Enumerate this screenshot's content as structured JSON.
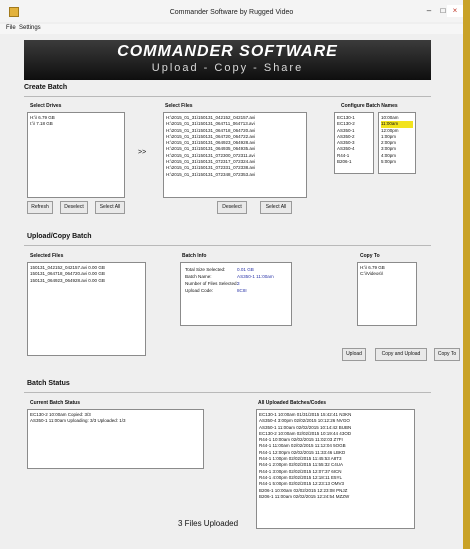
{
  "window": {
    "title": "Commander Software by Rugged Video",
    "minimize": "–",
    "maximize": "□",
    "close": "×"
  },
  "menu": {
    "file": "File",
    "settings": "Settings"
  },
  "banner": {
    "title": "COMMANDER SOFTWARE",
    "subtitle": "Upload - Copy - Share"
  },
  "create_batch": {
    "heading": "Create Batch",
    "select_drives_label": "Select Drives",
    "drives": [
      "H:\\\\ 6.79 GB",
      "I:\\\\ 7.18 GB"
    ],
    "select_files_label": "Select Files",
    "arrow": ">>",
    "files": [
      "H:\\2015_01_31\\150131_042152_042157.avi",
      "H:\\2015_01_31\\150131_064711_064713.avi",
      "H:\\2015_01_31\\150131_064718_064720.avi",
      "H:\\2015_01_31\\150131_064720_064722.avi",
      "H:\\2015_01_31\\150131_064923_064928.avi",
      "H:\\2015_01_31\\150131_064935_064935.avi",
      "H:\\2015_01_31\\150131_072300_072311.avi",
      "H:\\2015_01_31\\150131_072317_072324.avi",
      "H:\\2015_01_31\\150131_072331_072338.avi",
      "H:\\2015_01_31\\150131_072348_072353.avi"
    ],
    "configure_label": "Configure Batch Names",
    "batch_names": [
      "EC130-1",
      "EC130-2",
      "AS350-1",
      "AS350-2",
      "AS350-3",
      "AS350-4",
      "R44-1",
      "B206-1"
    ],
    "times": [
      "10:00am",
      "11:00am",
      "12:00pm",
      "1:00pm",
      "2:00pm",
      "3:00pm",
      "4:00pm",
      "5:00pm"
    ],
    "refresh": "Refresh",
    "deselect": "Deselect",
    "select_all": "Select All",
    "deselect2": "Deselect",
    "select_all2": "Select All"
  },
  "upload_copy": {
    "heading": "Upload/Copy Batch",
    "selected_files_label": "Selected Files",
    "selected_files": [
      "150131_042152_042157.avi 0.00 GB",
      "150131_064718_064720.avi 0.00 GB",
      "150131_064923_064928.avi 0.00 GB"
    ],
    "batch_info_label": "Batch Info",
    "info_keys": [
      "Total Size Selected:",
      "Batch Name:",
      "Number of Files Selected:",
      "Upload Code:"
    ],
    "info_values": [
      "0.01 GB",
      "AS350-1 11:00am",
      "3",
      "8C8I"
    ],
    "copy_to_label": "Copy To",
    "copy_to": [
      "H:\\\\ 6.79 GB",
      "C:\\\\Videos\\\\"
    ],
    "upload": "Upload",
    "copy_and_upload": "Copy and Upload",
    "copy_to_btn": "Copy To"
  },
  "batch_status": {
    "heading": "Batch Status",
    "current_label": "Current Batch Status",
    "current": [
      "EC130-2 10:00am Copied: 3/3",
      "AS350-1 11:00am Uploading: 3/3 Uploaded: 1/3"
    ],
    "all_label": "All Uploaded Batches/Codes",
    "all": [
      "EC130-1 10:00am 01/31/2015 15:42:41 N3KN",
      "AS350-4 3:00pm 02/02/2015 10:12:26 NVGO",
      "AS350-1 11:00am 02/02/2015 10:14:42 BUBN",
      "EC130-2 10:00am 02/02/2015 10:19:44 43OD",
      "R44-1 10:00am 02/02/2015 11:02:03 Z7FI",
      "R44-1 11:00am 02/02/2015 11:12:04 5OGB",
      "R44-1 12:00pm 02/02/2015 11:33:46 LBKD",
      "R44-1 1:00pm 02/02/2015 11:45:53 A8T3",
      "R44-1 2:00pm 02/02/2015 11:55:32 C4UA",
      "R44-1 3:00pm 02/02/2015 12:07:37 6ICN",
      "R44-1 4:00pm 02/02/2015 12:18:11 E5YL",
      "R44-1 5:00pm 02/02/2015 12:23:13 OMV3",
      "B206-1 10:00am 02/02/2015 12:23:08 PNJZ",
      "B206-1 11:00am 02/02/2015 12:24:54 MZZW"
    ]
  },
  "footer": {
    "files_uploaded": "3 Files Uploaded"
  },
  "colors": {
    "accent_yellow": "#f2e31e",
    "frame_gold": "#c9a227",
    "batch_value_blue": "#2b35a8"
  }
}
